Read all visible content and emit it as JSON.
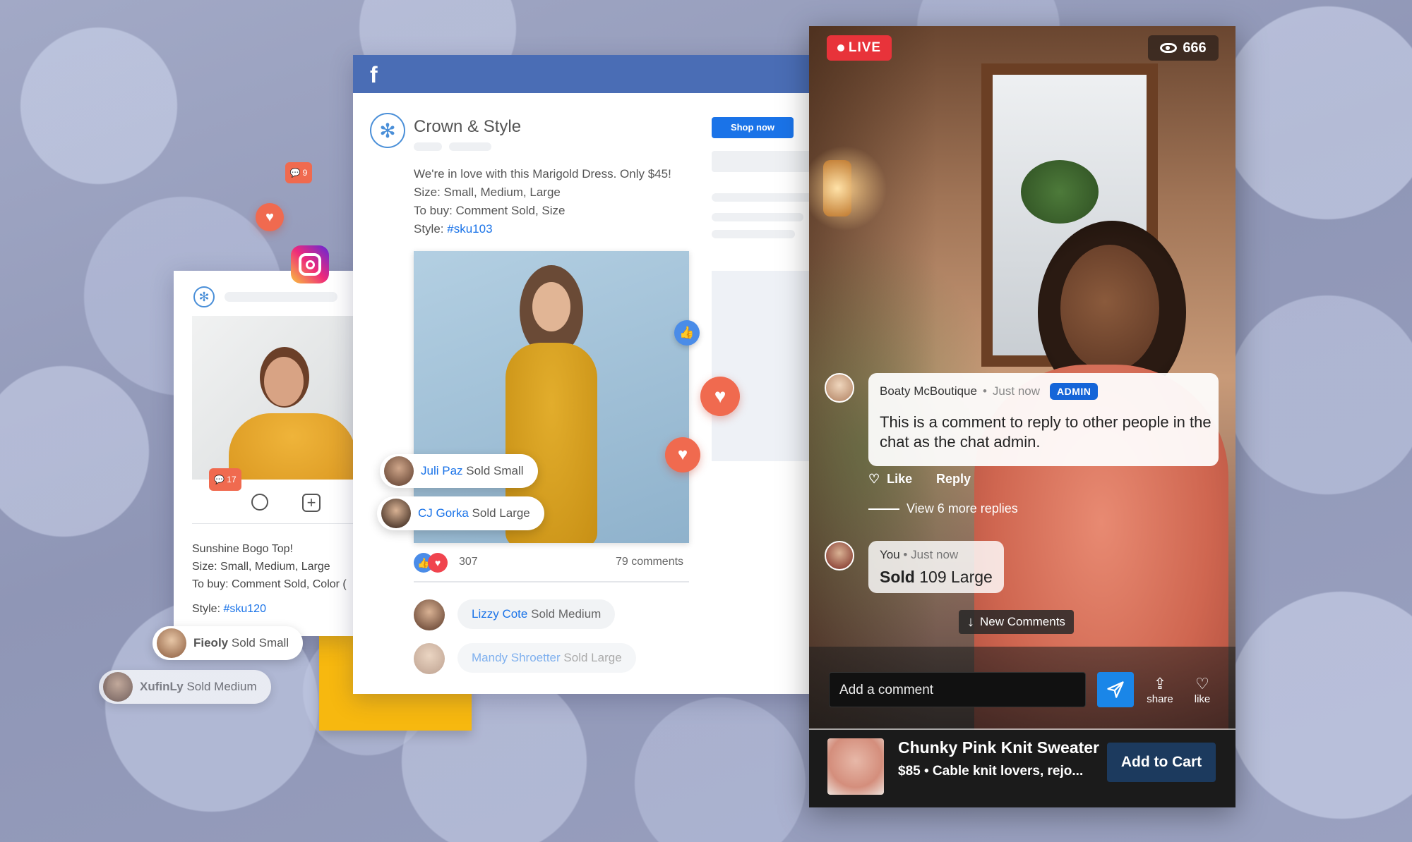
{
  "instagram": {
    "badge_count": "9",
    "photo_badge_count": "17",
    "caption_lines": [
      "Sunshine Bogo Top!",
      "Size: Small, Medium, Large",
      "To buy: Comment Sold, Color ("
    ],
    "style_label": "Style:",
    "style_tag": "#sku120"
  },
  "pills_left": [
    {
      "name": "Fieoly",
      "text": "Sold Small"
    },
    {
      "name": "XufinLy",
      "text": "Sold Medium"
    }
  ],
  "facebook": {
    "logo": "f",
    "page_name": "Crown & Style",
    "shop_button": "Shop now",
    "post_lines": [
      "We're in love with this Marigold Dress. Only $45!",
      "Size: Small, Medium, Large",
      "To buy: Comment Sold, Size"
    ],
    "style_label": "Style:",
    "style_tag": "#sku103",
    "photo_comments": [
      {
        "name": "Juli Paz",
        "text": "Sold Small"
      },
      {
        "name": "CJ Gorka",
        "text": "Sold Large"
      }
    ],
    "reaction_count": "307",
    "comment_count": "79 comments",
    "comments": [
      {
        "name": "Lizzy Cote",
        "text": "Sold Medium"
      },
      {
        "name": "Mandy Shroetter",
        "text": "Sold Large"
      }
    ]
  },
  "live": {
    "live_label": "LIVE",
    "viewer_count": "666",
    "admin_comment": {
      "author": "Boaty McBoutique",
      "time": "Just now",
      "badge": "ADMIN",
      "text": "This is a comment to reply to other people in the chat as the chat admin.",
      "like": "Like",
      "reply": "Reply",
      "more_replies": "View 6 more replies"
    },
    "my_comment": {
      "author": "You",
      "time": "Just now",
      "bold": "Sold",
      "text": "109 Large"
    },
    "new_comments": "New Comments",
    "input_placeholder": "Add a comment",
    "share_label": "share",
    "like_label": "like",
    "product": {
      "title": "Chunky Pink Knit Sweater",
      "price": "$85",
      "desc": "Cable knit lovers, rejo...",
      "cta": "Add to Cart"
    }
  },
  "colors": {
    "facebook_blue": "#4a6db5",
    "link_blue": "#1a73e8",
    "heart": "#f06a4f",
    "yellow": "#f7b80f",
    "live_red": "#e8333a",
    "admin_blue": "#1565d8",
    "send_blue": "#1a86e8",
    "cart_navy": "#1c3a5e"
  }
}
